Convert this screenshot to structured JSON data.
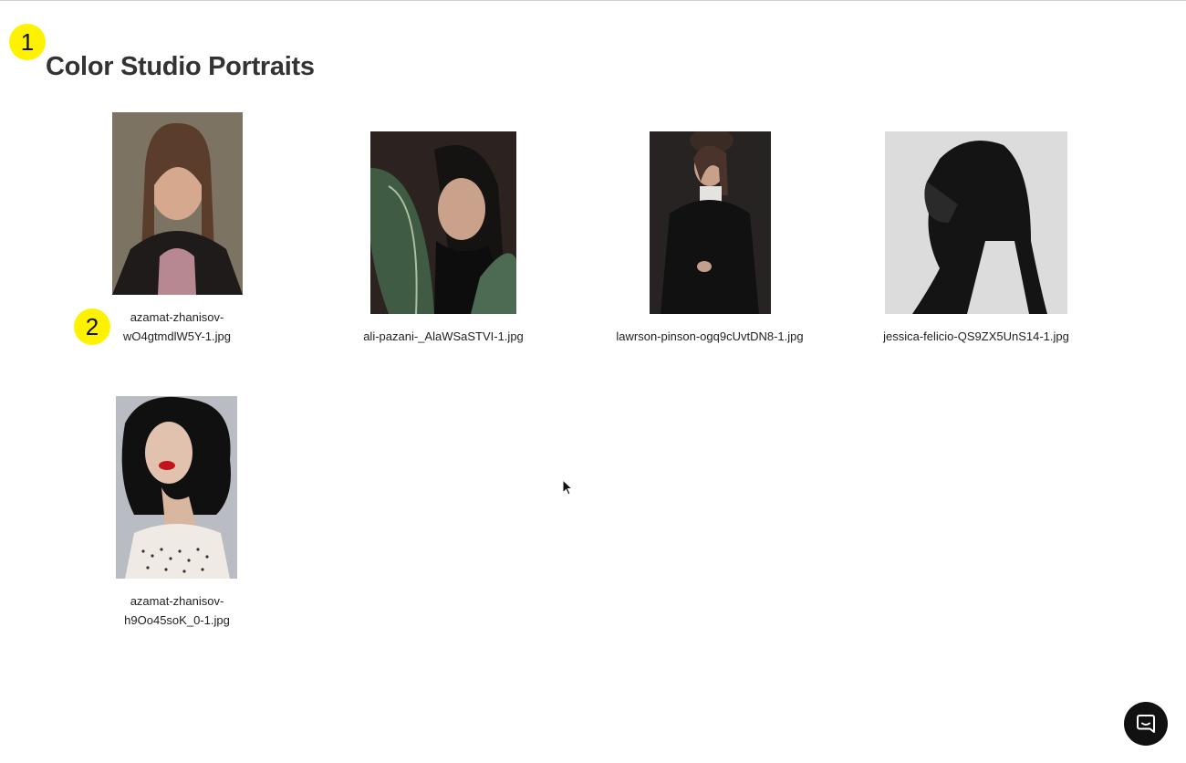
{
  "markers": [
    "1",
    "2"
  ],
  "gallery": {
    "title": "Color Studio Portraits",
    "items": [
      {
        "filename_line1": "azamat-zhanisov-",
        "filename_line2": "wO4gtmdlW5Y-1.jpg"
      },
      {
        "filename_line1": "ali-pazani-_AlaWSaSTVI-1.jpg",
        "filename_line2": ""
      },
      {
        "filename_line1": "lawrson-pinson-ogq9cUvtDN8-1.jpg",
        "filename_line2": ""
      },
      {
        "filename_line1": "jessica-felicio-QS9ZX5UnS14-1.jpg",
        "filename_line2": ""
      },
      {
        "filename_line1": "azamat-zhanisov-",
        "filename_line2": "h9Oo45soK_0-1.jpg"
      }
    ]
  },
  "chat": {
    "icon": "chat-bubble-icon"
  }
}
